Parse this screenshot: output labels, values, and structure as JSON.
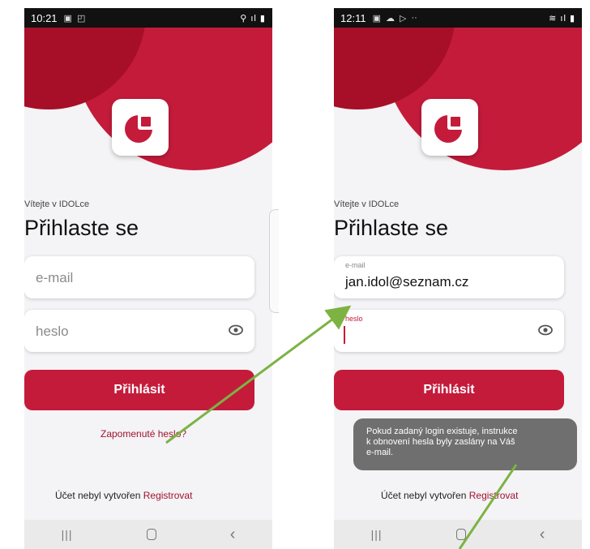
{
  "left_screen": {
    "status": {
      "time": "10:21"
    },
    "welcome": "Vítejte v IDOLce",
    "title": "Přihlaste se",
    "email_placeholder": "e-mail",
    "password_placeholder": "heslo",
    "login_button": "Přihlásit",
    "forgot_link": "Zapomenuté heslo?",
    "no_account": "Účet nebyl vytvořen",
    "register": "Registrovat"
  },
  "right_screen": {
    "status": {
      "time": "12:11"
    },
    "welcome": "Vítejte v IDOLce",
    "title": "Přihlaste se",
    "email_label": "e-mail",
    "email_value": "jan.idol@seznam.cz",
    "password_label": "heslo",
    "login_button": "Přihlásit",
    "toast": {
      "line1": "Pokud zadaný login existuje, instrukce",
      "line2": "k obnovení hesla byly zaslány na Váš",
      "line3": "e-mail."
    },
    "no_account": "Účet nebyl vytvořen",
    "register": "Registrovat"
  },
  "colors": {
    "brand": "#c41b3b",
    "brand_dark": "#a60f27",
    "annotation_arrow": "#7cb342"
  },
  "icons": [
    "eye-icon",
    "brand-logo",
    "nav-recent-icon",
    "nav-home-icon",
    "nav-back-icon"
  ]
}
